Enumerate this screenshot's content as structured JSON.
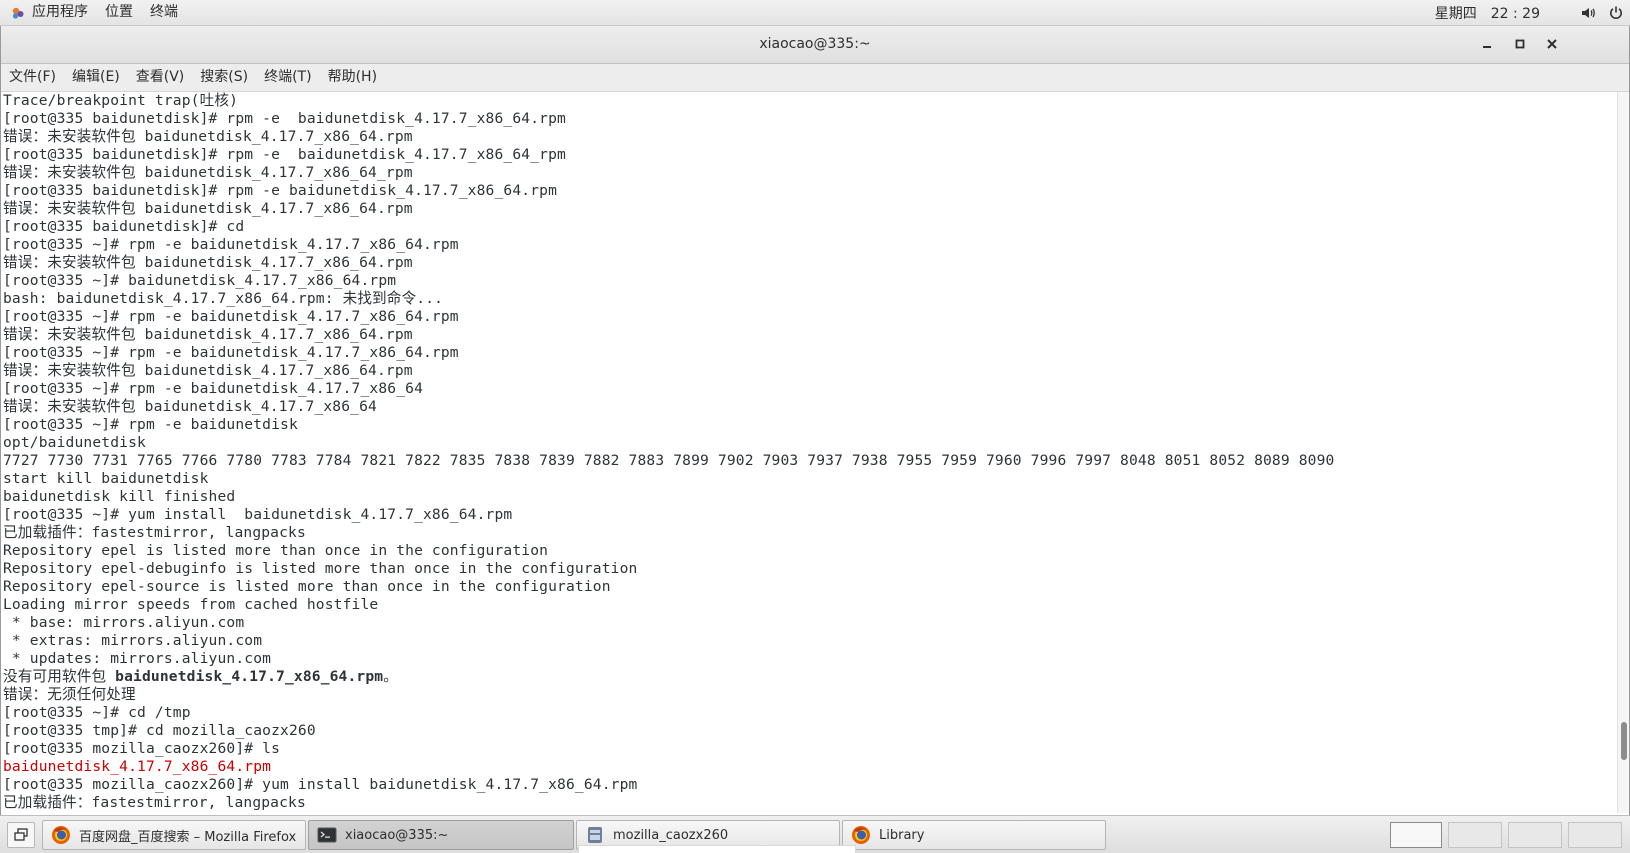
{
  "top_panel": {
    "applications": "应用程序",
    "places": "位置",
    "terminal": "终端",
    "weekday": "星期四",
    "time_hour": "22",
    "time_minute": "29",
    "volume_icon": "volume-icon",
    "power_icon": "power-icon"
  },
  "window": {
    "title": "xiaocao@335:~",
    "minimize": "minimize-icon",
    "maximize": "maximize-icon",
    "close": "close-icon"
  },
  "menubar": [
    "文件(F)",
    "编辑(E)",
    "查看(V)",
    "搜索(S)",
    "终端(T)",
    "帮助(H)"
  ],
  "terminal": {
    "lines": [
      {
        "text": "Trace/breakpoint trap(吐核)",
        "style": ""
      },
      {
        "text": "[root@335 baidunetdisk]# rpm -e  baidunetdisk_4.17.7_x86_64.rpm",
        "style": ""
      },
      {
        "text": "错误：未安装软件包 baidunetdisk_4.17.7_x86_64.rpm",
        "style": ""
      },
      {
        "text": "[root@335 baidunetdisk]# rpm -e  baidunetdisk_4.17.7_x86_64_rpm",
        "style": ""
      },
      {
        "text": "错误：未安装软件包 baidunetdisk_4.17.7_x86_64_rpm",
        "style": ""
      },
      {
        "text": "[root@335 baidunetdisk]# rpm -e baidunetdisk_4.17.7_x86_64.rpm",
        "style": ""
      },
      {
        "text": "错误：未安装软件包 baidunetdisk_4.17.7_x86_64.rpm",
        "style": ""
      },
      {
        "text": "[root@335 baidunetdisk]# cd",
        "style": ""
      },
      {
        "text": "[root@335 ~]# rpm -e baidunetdisk_4.17.7_x86_64.rpm",
        "style": ""
      },
      {
        "text": "错误：未安装软件包 baidunetdisk_4.17.7_x86_64.rpm",
        "style": ""
      },
      {
        "text": "[root@335 ~]# baidunetdisk_4.17.7_x86_64.rpm",
        "style": ""
      },
      {
        "text": "bash: baidunetdisk_4.17.7_x86_64.rpm: 未找到命令...",
        "style": ""
      },
      {
        "text": "[root@335 ~]# rpm -e baidunetdisk_4.17.7_x86_64.rpm",
        "style": ""
      },
      {
        "text": "错误：未安装软件包 baidunetdisk_4.17.7_x86_64.rpm",
        "style": ""
      },
      {
        "text": "[root@335 ~]# rpm -e baidunetdisk_4.17.7_x86_64.rpm",
        "style": ""
      },
      {
        "text": "错误：未安装软件包 baidunetdisk_4.17.7_x86_64.rpm",
        "style": ""
      },
      {
        "text": "[root@335 ~]# rpm -e baidunetdisk_4.17.7_x86_64",
        "style": ""
      },
      {
        "text": "错误：未安装软件包 baidunetdisk_4.17.7_x86_64",
        "style": ""
      },
      {
        "text": "[root@335 ~]# rpm -e baidunetdisk",
        "style": ""
      },
      {
        "text": "opt/baidunetdisk",
        "style": ""
      },
      {
        "text": "7727 7730 7731 7765 7766 7780 7783 7784 7821 7822 7835 7838 7839 7882 7883 7899 7902 7903 7937 7938 7955 7959 7960 7996 7997 8048 8051 8052 8089 8090",
        "style": ""
      },
      {
        "text": "start kill baidunetdisk",
        "style": ""
      },
      {
        "text": "baidunetdisk kill finished",
        "style": ""
      },
      {
        "text": "[root@335 ~]# yum install  baidunetdisk_4.17.7_x86_64.rpm",
        "style": ""
      },
      {
        "text": "已加载插件：fastestmirror, langpacks",
        "style": ""
      },
      {
        "text": "Repository epel is listed more than once in the configuration",
        "style": ""
      },
      {
        "text": "Repository epel-debuginfo is listed more than once in the configuration",
        "style": ""
      },
      {
        "text": "Repository epel-source is listed more than once in the configuration",
        "style": ""
      },
      {
        "text": "Loading mirror speeds from cached hostfile",
        "style": ""
      },
      {
        "text": " * base: mirrors.aliyun.com",
        "style": ""
      },
      {
        "text": " * extras: mirrors.aliyun.com",
        "style": ""
      },
      {
        "text": " * updates: mirrors.aliyun.com",
        "style": ""
      },
      {
        "text": "没有可用软件包 ",
        "bold_tail": "baidunetdisk_4.17.7_x86_64.rpm",
        "tail": "。",
        "style": ""
      },
      {
        "text": "错误：无须任何处理",
        "style": ""
      },
      {
        "text": "[root@335 ~]# cd /tmp",
        "style": ""
      },
      {
        "text": "[root@335 tmp]# cd mozilla_caozx260",
        "style": ""
      },
      {
        "text": "[root@335 mozilla_caozx260]# ls",
        "style": ""
      },
      {
        "text": "baidunetdisk_4.17.7_x86_64.rpm",
        "style": "red"
      },
      {
        "text": "[root@335 mozilla_caozx260]# yum install baidunetdisk_4.17.7_x86_64.rpm",
        "style": ""
      },
      {
        "text": "已加载插件：fastestmirror, langpacks",
        "style": ""
      }
    ]
  },
  "taskbar": {
    "show_desktop_icon": "show-desktop-icon",
    "tasks": [
      {
        "label": "百度网盘_百度搜索 – Mozilla Firefox",
        "icon": "firefox-icon",
        "active": false
      },
      {
        "label": "xiaocao@335:~",
        "icon": "terminal-icon",
        "active": true
      },
      {
        "label": "mozilla_caozx260",
        "icon": "folder-icon",
        "active": false
      },
      {
        "label": "Library",
        "icon": "firefox-icon",
        "active": false
      }
    ],
    "workspaces": 4
  }
}
